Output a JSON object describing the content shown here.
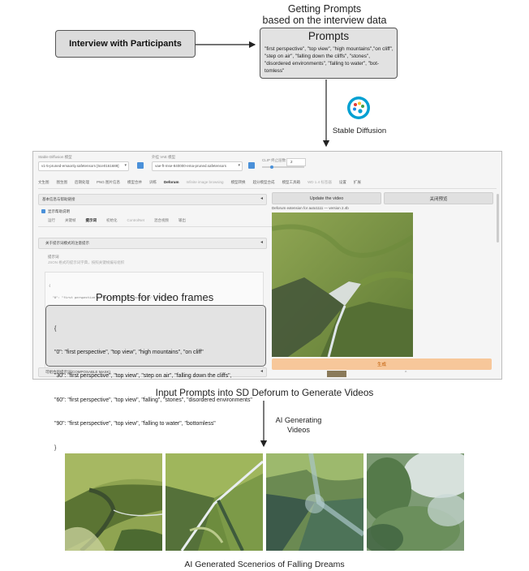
{
  "interview_box": "Interview with Participants",
  "getting_prompts": [
    "Getting Prompts",
    "based on the interview data"
  ],
  "prompts_box": {
    "title": "Prompts",
    "text": "\"first perspective\", \"top view\", \"high mountains\",\"on cliff\",  \"step on air\", \"falling down the cliffs\", \"stones\", \"disordered environments\", \"falling to water\", \"bot-tomless\""
  },
  "stable_diffusion": "Stable Diffusion",
  "webui": {
    "model_label": "Stable Diffusion 模型",
    "model_value": "v1-5-pruned-emaonly.safetensors [6ce0161689]",
    "vae_label": "外挂 VAE 模型",
    "vae_value": "vae-ft-mse-840000-ema-pruned.safetensors",
    "clip_label": "CLIP 终止层数",
    "clip_value": "2",
    "tabs": [
      "文生图",
      "图生图",
      "后期处理",
      "PNG 图片信息",
      "模型合并",
      "训练",
      "Deforum",
      "Infinite image browsing",
      "模型转换",
      "超分模型合成",
      "模型工具箱",
      "WD 1.4 标签器",
      "设置",
      "扩展"
    ],
    "basic_section": "基本信息与帮助链接",
    "show_info": "显示帮助说明",
    "subtabs": [
      "运行",
      "关键帧",
      "提示词",
      "初始化",
      "ControlNet",
      "混合视频",
      "输出"
    ],
    "prompt_section": "关于提示词模式的注意提示",
    "prompts_label": "提示词",
    "prompts_hint": "JSON 格式的提示词字典，按照关键帧编号组织",
    "update_video": "Update the video",
    "close_preview": "关闭预览",
    "deforum_ext": "Deforum extension for auto1111 — version 2.4b",
    "generate": "生成",
    "composable": "可组合的提示词(COMPOSABLE MASK)",
    "code_lines": [
      "{",
      "  \"0\": \"first perspective\", \"top view\", \"high mountains\", \"on cliff\"",
      "  \"30\": \"first perspective\", \"top view\", \"step on air\", \"falling down the cliffs\"",
      "  \"60\": \"first perspective\", \"top view\", \"falling\", \"stones\", \"disordered environments\"",
      "  \"90\": \"first perspective\", \"top view\", \"falling to water\", \"bottomless\"",
      "}"
    ]
  },
  "prompts_for_frames": {
    "title": "Prompts for video frames",
    "lines": [
      "{",
      "\"0\": \"first perspective\", \"top view\", \"high mountains\", \"on cliff\"",
      "\"30\": \"first perspective\", \"top view\", \"step on air\", \"falling down the cliffs\",",
      "\"60\": \"first perspective\", \"top view\", \"falling\", \"stones\", \"disordered environments\"",
      "\"90\": \"first perspective\", \"top view\", \"falling to water\", \"bottomless\"",
      "}"
    ]
  },
  "caption_input": "Input Prompts into SD Deforum to Generate Videos",
  "ai_generating": [
    "AI Generating",
    "Videos"
  ],
  "caption_bottom": "AI Generated Scenerios of Falling Dreams",
  "colors": {
    "box_fill": "#dcdcdc",
    "border": "#555555",
    "generate_button": "#f7c79a",
    "terrain_green": "#7f9a49",
    "logo_ring": "#00a0d2"
  },
  "icons": [
    "arrow-icon",
    "palette-icon",
    "dropdown-icon",
    "refresh-icon"
  ]
}
